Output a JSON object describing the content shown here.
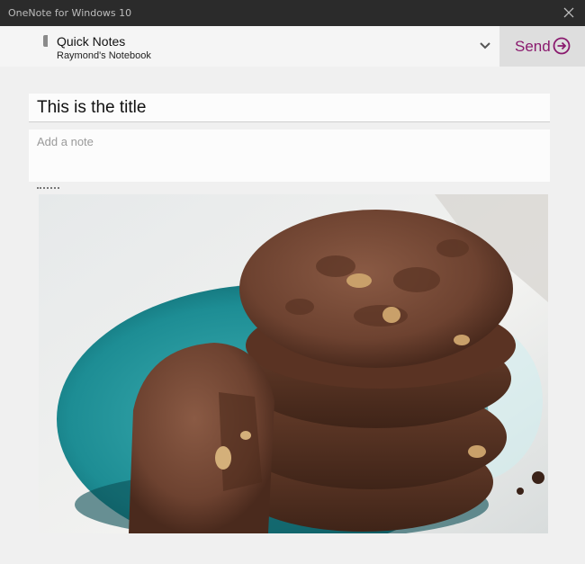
{
  "window": {
    "title": "OneNote for Windows 10"
  },
  "header": {
    "section": "Quick Notes",
    "notebook": "Raymond's Notebook",
    "send_label": "Send"
  },
  "note": {
    "title": "This is the title",
    "placeholder": "Add a note"
  },
  "colors": {
    "accent": "#8a1a6e",
    "titlebar": "#2b2b2b",
    "background": "#f0f0f0"
  },
  "icons": [
    "close-icon",
    "chevron-down-icon",
    "arrow-circle-right-icon",
    "section-marker-icon"
  ]
}
